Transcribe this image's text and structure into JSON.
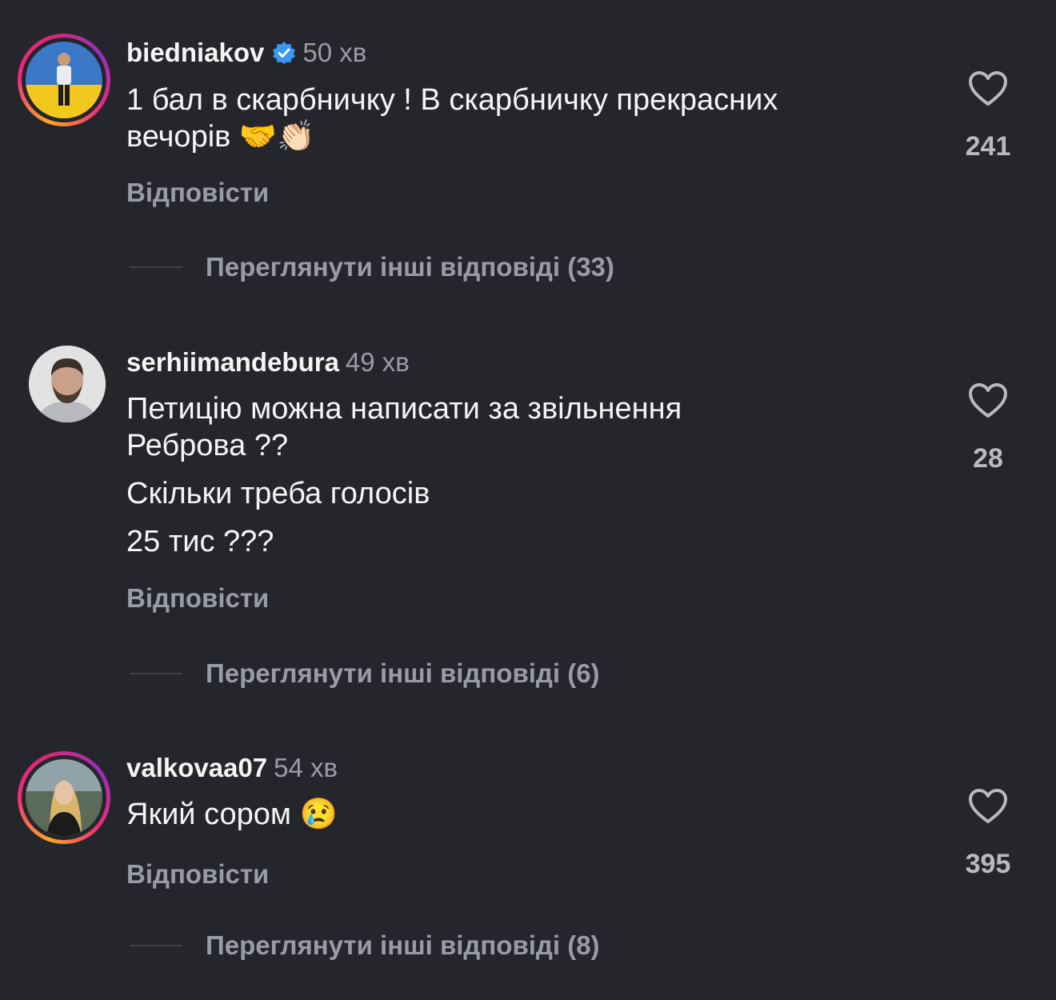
{
  "comments": [
    {
      "username": "biedniakov",
      "verified": true,
      "time": "50 хв",
      "lines": [
        "1 бал в скарбничку ! В скарбничку прекрасних",
        "вечорів 🤝👏🏻"
      ],
      "reply_label": "Відповісти",
      "likes": "241",
      "view_replies": "Переглянути інші відповіді (33)",
      "avatar_ring": true
    },
    {
      "username": "serhiimandebura",
      "verified": false,
      "time": "49 хв",
      "lines": [
        "Петицію можна написати за звільнення",
        "Реброва ??",
        "Скільки треба голосів",
        "25 тис ???"
      ],
      "reply_label": "Відповісти",
      "likes": "28",
      "view_replies": "Переглянути інші відповіді (6)",
      "avatar_ring": false
    },
    {
      "username": "valkovaa07",
      "verified": false,
      "time": "54 хв",
      "lines": [
        "Який сором 😢"
      ],
      "reply_label": "Відповісти",
      "likes": "395",
      "view_replies": "Переглянути інші відповіді (8)",
      "avatar_ring": true
    }
  ],
  "icons": {
    "like": "heart-outline-icon",
    "verified": "verified-badge-icon"
  },
  "colors": {
    "background": "#25262b",
    "muted_text": "#9a9ca3",
    "verified_blue": "#3897f0"
  }
}
